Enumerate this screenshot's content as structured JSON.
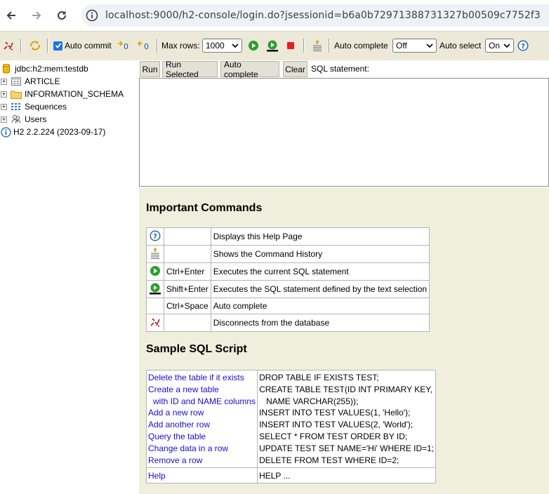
{
  "browser": {
    "url": "localhost:9000/h2-console/login.do?jsessionid=b6a0b72971388731327b00509c7752f3"
  },
  "toolbar": {
    "auto_commit_label": "Auto commit",
    "auto_commit_checked": true,
    "max_rows_label": "Max rows:",
    "max_rows_value": "1000",
    "auto_complete_label": "Auto complete",
    "auto_complete_value": "Off",
    "auto_select_label": "Auto select",
    "auto_select_value": "On"
  },
  "tree": {
    "connection": "jdbc:h2:mem:testdb",
    "items": [
      {
        "label": "ARTICLE",
        "icon": "table-icon"
      },
      {
        "label": "INFORMATION_SCHEMA",
        "icon": "folder-icon"
      },
      {
        "label": "Sequences",
        "icon": "sequences-icon"
      },
      {
        "label": "Users",
        "icon": "users-icon"
      }
    ],
    "version": "H2 2.2.224 (2023-09-17)"
  },
  "query": {
    "run": "Run",
    "run_selected": "Run Selected",
    "auto_complete": "Auto complete",
    "clear": "Clear",
    "sql_label": "SQL statement:",
    "sql_text": ""
  },
  "help": {
    "important_title": "Important Commands",
    "commands": [
      {
        "icon": "help-icon",
        "key": "",
        "desc": "Displays this Help Page"
      },
      {
        "icon": "history-icon",
        "key": "",
        "desc": "Shows the Command History"
      },
      {
        "icon": "run-icon",
        "key": "Ctrl+Enter",
        "desc": "Executes the current SQL statement"
      },
      {
        "icon": "run-selected-icon",
        "key": "Shift+Enter",
        "desc": "Executes the SQL statement defined by the text selection"
      },
      {
        "icon": "",
        "key": "Ctrl+Space",
        "desc": "Auto complete"
      },
      {
        "icon": "disconnect-icon",
        "key": "",
        "desc": "Disconnects from the database"
      }
    ],
    "sample_title": "Sample SQL Script",
    "samples": [
      {
        "links": [
          "Delete the table if it exists"
        ],
        "sql": [
          "DROP TABLE IF EXISTS TEST;"
        ]
      },
      {
        "links": [
          "Create a new table",
          "with ID and NAME columns"
        ],
        "sql": [
          "CREATE TABLE TEST(ID INT PRIMARY KEY,",
          "NAME VARCHAR(255));"
        ]
      },
      {
        "links": [
          "Add a new row"
        ],
        "sql": [
          "INSERT INTO TEST VALUES(1, 'Hello');"
        ]
      },
      {
        "links": [
          "Add another row"
        ],
        "sql": [
          "INSERT INTO TEST VALUES(2, 'World');"
        ]
      },
      {
        "links": [
          "Query the table"
        ],
        "sql": [
          "SELECT * FROM TEST ORDER BY ID;"
        ]
      },
      {
        "links": [
          "Change data in a row"
        ],
        "sql": [
          "UPDATE TEST SET NAME='Hi' WHERE ID=1;"
        ]
      },
      {
        "links": [
          "Remove a row"
        ],
        "sql": [
          "DELETE FROM TEST WHERE ID=2;"
        ]
      }
    ],
    "help_link": "Help",
    "help_sql": "HELP ..."
  },
  "colors": {
    "toolbar_bg": "#ece9d8",
    "panel_bg": "#f0eedd",
    "link": "#1a0dcc",
    "run_green": "#2e9e2e",
    "stop_red": "#e02020"
  }
}
